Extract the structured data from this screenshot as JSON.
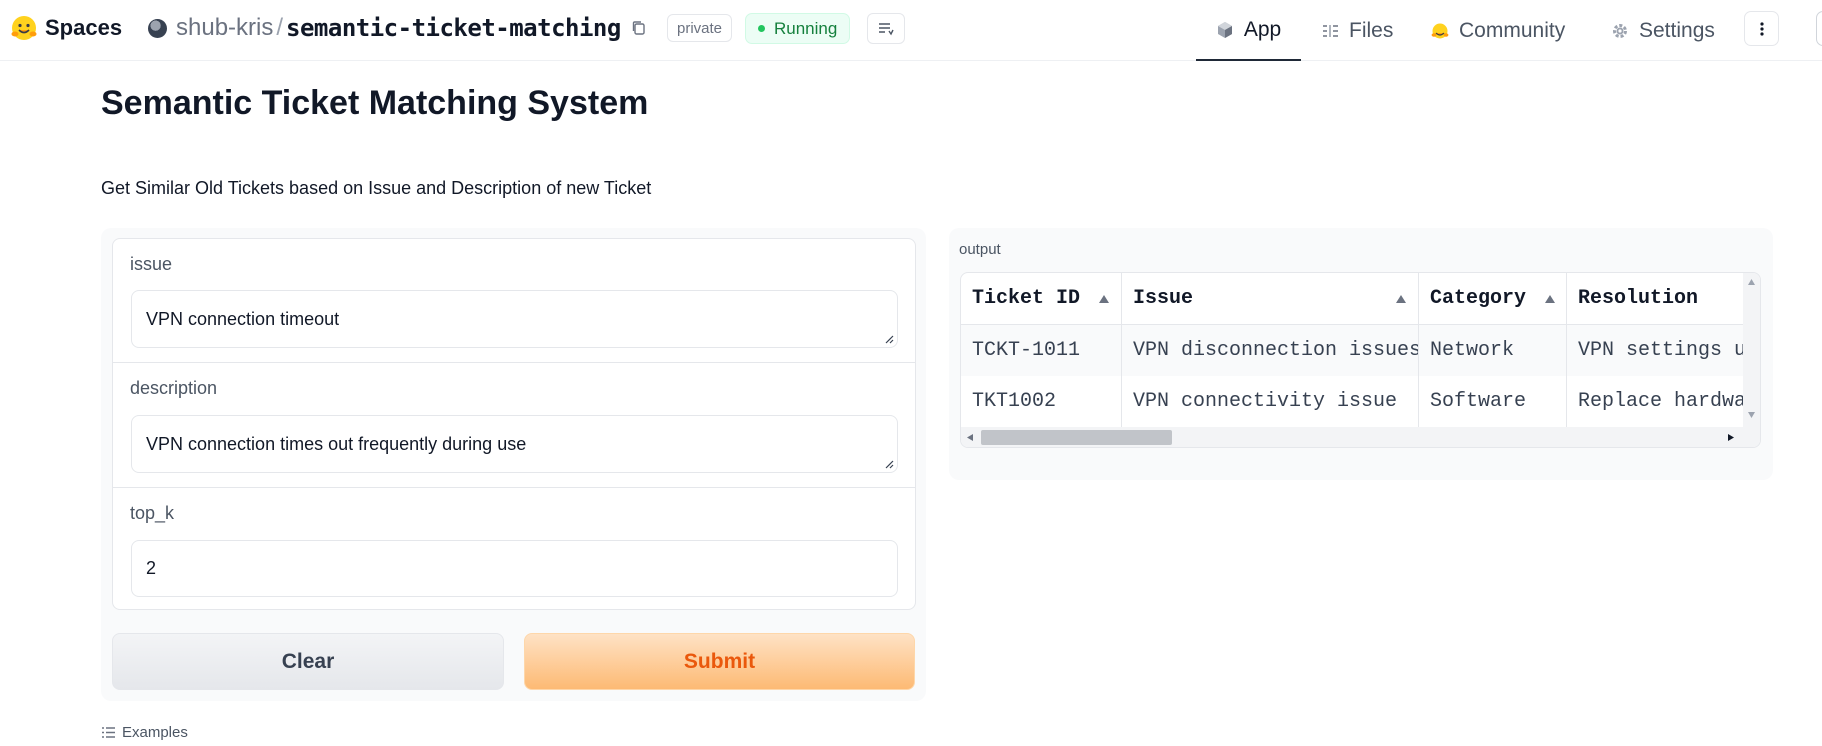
{
  "header": {
    "brand": "Spaces",
    "owner": "shub-kris",
    "separator": "/",
    "repo_name": "semantic-ticket-matching",
    "visibility_badge": "private",
    "status_badge": "Running",
    "nav": [
      {
        "label": "App",
        "icon": "cube-icon",
        "active": true
      },
      {
        "label": "Files",
        "icon": "files-icon",
        "active": false
      },
      {
        "label": "Community",
        "icon": "hugging-face-icon",
        "active": false
      },
      {
        "label": "Settings",
        "icon": "gear-icon",
        "active": false
      }
    ]
  },
  "page": {
    "title": "Semantic Ticket Matching System",
    "description": "Get Similar Old Tickets based on Issue and Description of new Ticket"
  },
  "form": {
    "issue_label": "issue",
    "issue_value": "VPN connection timeout",
    "description_label": "description",
    "description_value": "VPN connection times out frequently during use",
    "top_k_label": "top_k",
    "top_k_value": "2",
    "clear_label": "Clear",
    "submit_label": "Submit",
    "examples_label": "Examples"
  },
  "output": {
    "label": "output",
    "columns": [
      "Ticket ID",
      "Issue",
      "Category",
      "Resolution"
    ],
    "rows": [
      [
        "TCKT-1011",
        "VPN disconnection issues",
        "Network",
        "VPN settings u"
      ],
      [
        "TKT1002",
        "VPN connectivity issue",
        "Software",
        "Replace hardwa"
      ]
    ]
  },
  "colors": {
    "accent_orange": "#ea580c",
    "running_green": "#22c55e"
  }
}
